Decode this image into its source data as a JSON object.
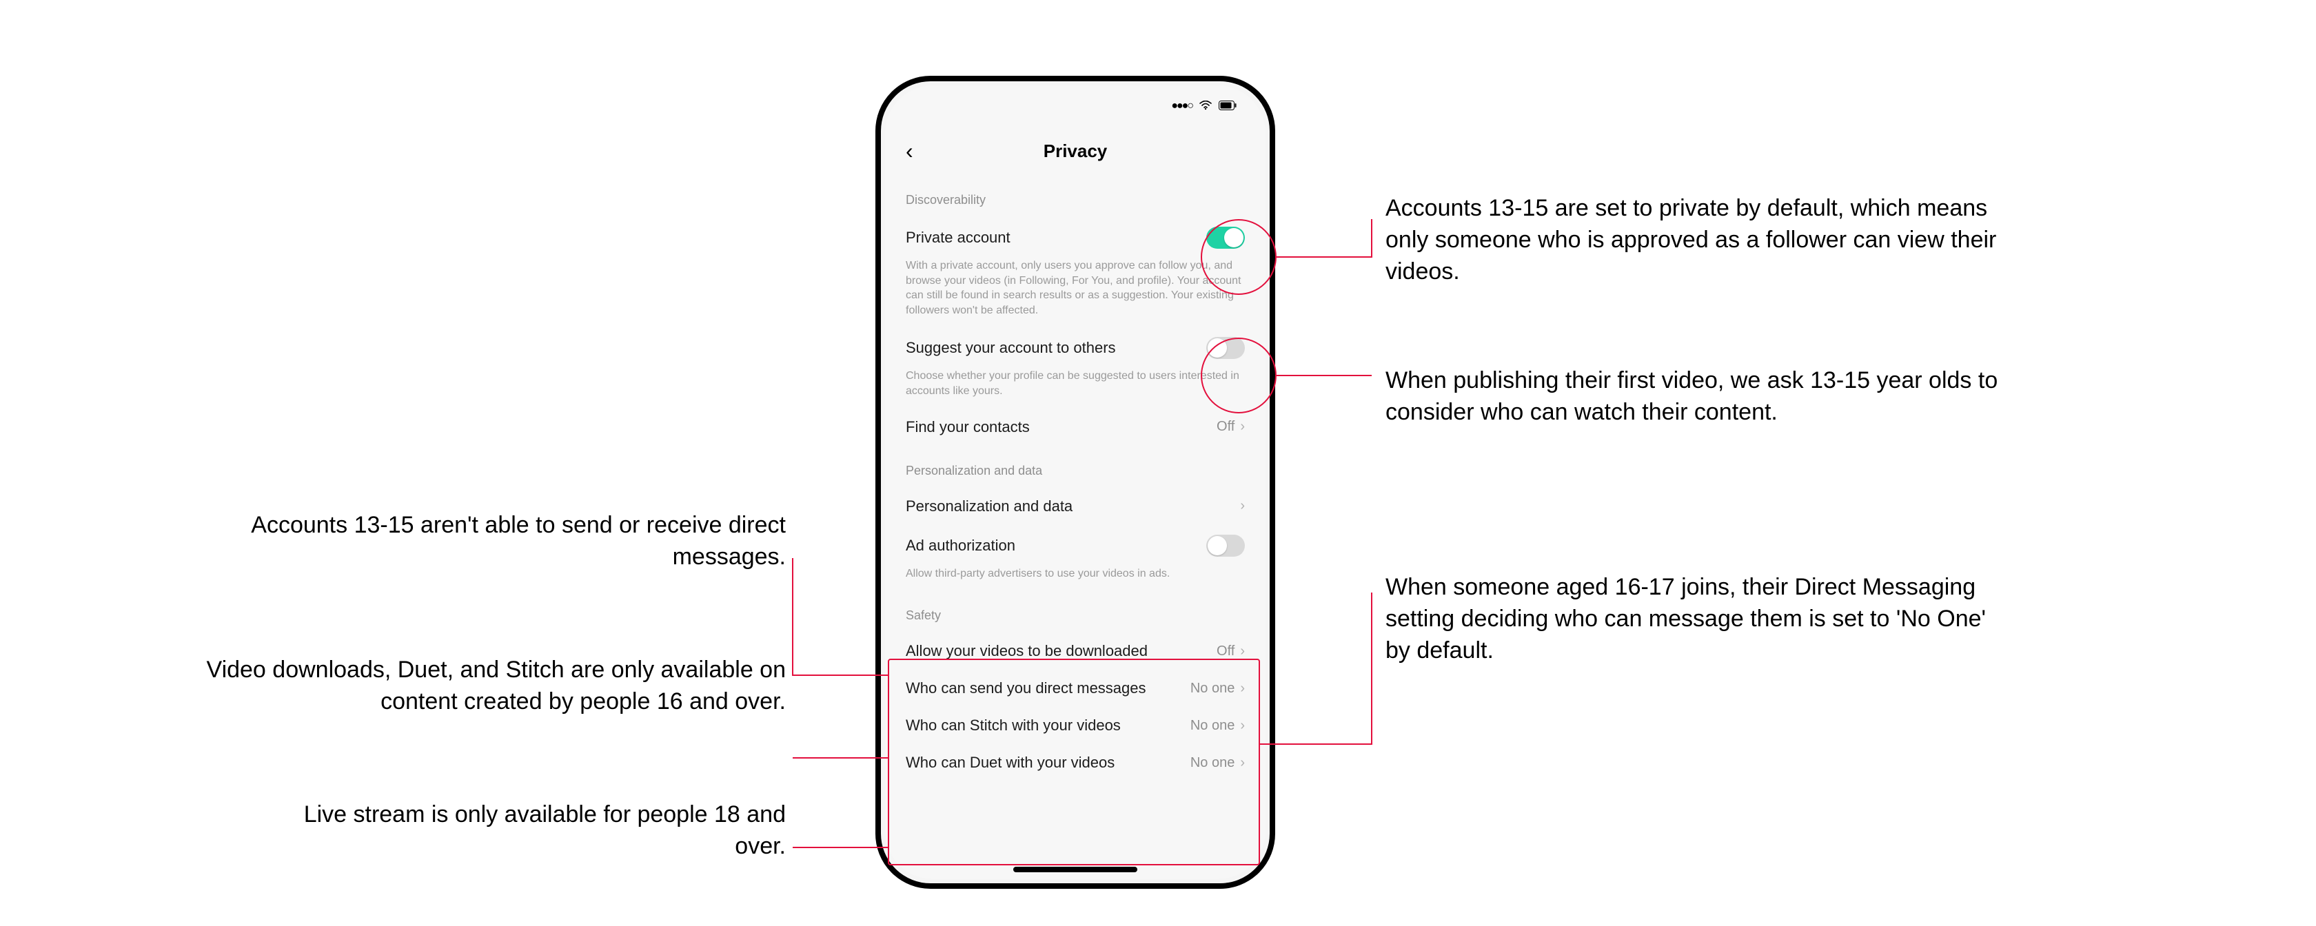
{
  "phone": {
    "nav": {
      "title": "Privacy"
    },
    "sections": {
      "discoverability": {
        "header": "Discoverability",
        "privateAccount": {
          "label": "Private account",
          "desc": "With a private account, only users you approve can follow you, and browse your videos (in Following, For You, and profile). Your account can still be found in search results or as a suggestion. Your existing followers won't be affected."
        },
        "suggest": {
          "label": "Suggest your account to others",
          "desc": "Choose whether your profile can be suggested to users interested in accounts like yours."
        },
        "findContacts": {
          "label": "Find your contacts",
          "value": "Off"
        }
      },
      "personalization": {
        "header": "Personalization and data",
        "row": {
          "label": "Personalization and data"
        },
        "adAuth": {
          "label": "Ad authorization",
          "desc": "Allow third-party advertisers to use your videos in ads."
        }
      },
      "safety": {
        "header": "Safety",
        "downloads": {
          "label": "Allow your videos to be downloaded",
          "value": "Off"
        },
        "dm": {
          "label": "Who can send you direct messages",
          "value": "No one"
        },
        "stitch": {
          "label": "Who can Stitch with your videos",
          "value": "No one"
        },
        "duet": {
          "label": "Who can Duet with your videos",
          "value": "No one"
        }
      }
    }
  },
  "annotations": {
    "left1": "Accounts 13-15 aren't able to send or receive direct messages.",
    "left2": "Video downloads, Duet, and Stitch are only available on content created by people 16 and over.",
    "left3": "Live stream is only available for people 18 and over.",
    "right1a": "Accounts 13-15 are set to private by default, which means only someone who is approved as a follower can view their videos.",
    "right1b": "When publishing their first video, we ask 13-15 year olds to consider who can watch their content.",
    "right2": "When someone aged 16-17 joins, their Direct Messaging setting deciding who can message them is set to 'No One' by default."
  }
}
